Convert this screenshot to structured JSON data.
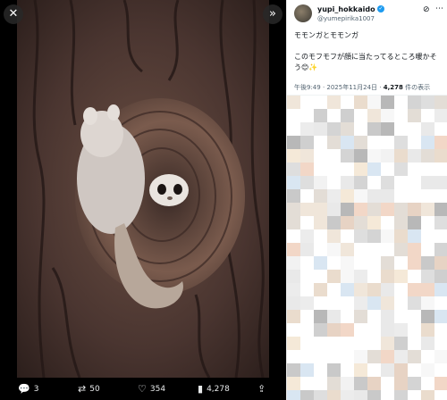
{
  "viewer": {
    "close_icon": "close-icon",
    "expand_icon": "expand-icon",
    "photo_alt": "モモンガ photo"
  },
  "actions": {
    "reply_count": "3",
    "retweet_count": "50",
    "like_count": "354",
    "view_count": "4,278"
  },
  "tweet": {
    "display_name": "yupi_hokkaido",
    "handle": "@yumepirika1007",
    "line1": "モモンガとモモンガ",
    "line2": "このモフモフが顔に当たってるところ暖かそう😊✨",
    "time": "午後9:49 · 2025年11月24日 · ",
    "views_number": "4,278",
    "views_label": " 件の表示"
  },
  "colors": {
    "accent": "#1d9bf0",
    "text": "#0f1419",
    "muted": "#536471"
  }
}
